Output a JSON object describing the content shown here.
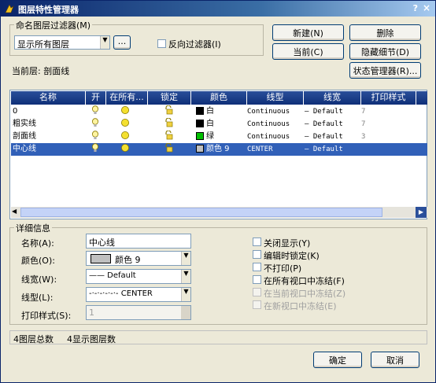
{
  "window": {
    "title": "图层特性管理器",
    "help": "?",
    "close": "×"
  },
  "filter": {
    "group_label": "命名图层过滤器(M)",
    "selected": "显示所有图层",
    "ellipsis": "...",
    "reverse_label": "反向过滤器(I)"
  },
  "buttons": {
    "new": "新建(N)",
    "delete": "删除",
    "current": "当前(C)",
    "hide_details": "隐藏细节(D)",
    "state_manager": "状态管理器(R)...",
    "ok": "确定",
    "cancel": "取消"
  },
  "current_layer": "当前层: 剖面线",
  "table": {
    "headers": [
      "名称",
      "开",
      "在所有...",
      "锁定",
      "颜色",
      "线型",
      "线宽",
      "打印样式"
    ],
    "rows": [
      {
        "name": "0",
        "color": "白",
        "color_hex": "#000000",
        "linetype": "Continuous",
        "lineweight": "— Default",
        "plot": "7"
      },
      {
        "name": "粗实线",
        "color": "白",
        "color_hex": "#000000",
        "linetype": "Continuous",
        "lineweight": "— Default",
        "plot": "7"
      },
      {
        "name": "剖面线",
        "color": "绿",
        "color_hex": "#00c000",
        "linetype": "Continuous",
        "lineweight": "— Default",
        "plot": "3"
      },
      {
        "name": "中心线",
        "color": "颜色 9",
        "color_hex": "#c0c0c0",
        "linetype": "CENTER",
        "lineweight": "— Default",
        "plot": ""
      }
    ]
  },
  "details": {
    "group_label": "详细信息",
    "name_label": "名称(A):",
    "name_value": "中心线",
    "color_label": "颜色(O):",
    "color_value": "颜色 9",
    "lineweight_label": "线宽(W):",
    "lineweight_value": "—— Default",
    "linetype_label": "线型(L):",
    "linetype_value": "-·-·-·-·-·- CENTER",
    "plotstyle_label": "打印样式(S):",
    "plotstyle_value": "1",
    "options": [
      {
        "label": "关闭显示(Y)",
        "enabled": true
      },
      {
        "label": "编辑时锁定(K)",
        "enabled": true
      },
      {
        "label": "不打印(P)",
        "enabled": true
      },
      {
        "label": "在所有视口中冻结(F)",
        "enabled": true
      },
      {
        "label": "在当前视口中冻结(Z)",
        "enabled": false
      },
      {
        "label": "在新视口中冻结(E)",
        "enabled": false
      }
    ]
  },
  "status": {
    "total": "4图层总数",
    "shown": "4显示图层数"
  },
  "colors": {
    "selection": "#3160b8",
    "header": "#1f3f8a"
  }
}
